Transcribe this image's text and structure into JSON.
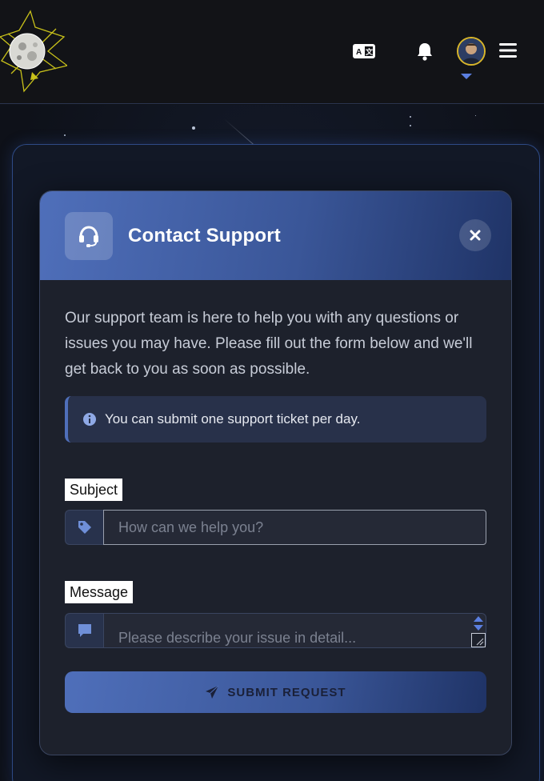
{
  "header": {
    "icons": {
      "logo": "moon-logo",
      "translate": "translate-icon",
      "notifications": "bell-icon",
      "avatar": "user-avatar",
      "menu": "hamburger-menu-icon"
    }
  },
  "modal": {
    "title": "Contact Support",
    "header_icon": "headset-icon",
    "close_icon": "close-icon",
    "intro": "Our support team is here to help you with any questions or issues you may have. Please fill out the form below and we'll get back to you as soon as possible.",
    "notice": "You can submit one support ticket per day.",
    "notice_icon": "info-icon",
    "subject": {
      "label": "Subject",
      "placeholder": "How can we help you?",
      "value": "",
      "icon": "tag-icon"
    },
    "message": {
      "label": "Message",
      "placeholder": "Please describe your issue in detail...",
      "value": "",
      "icon": "comment-icon"
    },
    "submit": {
      "label": "SUBMIT REQUEST",
      "icon": "paper-plane-icon"
    }
  },
  "colors": {
    "accent": "#4f6fba",
    "accent_dark": "#1f3366",
    "background": "#0f1218",
    "modal_bg": "#1d212c",
    "avatar_ring": "#d9b62a"
  }
}
